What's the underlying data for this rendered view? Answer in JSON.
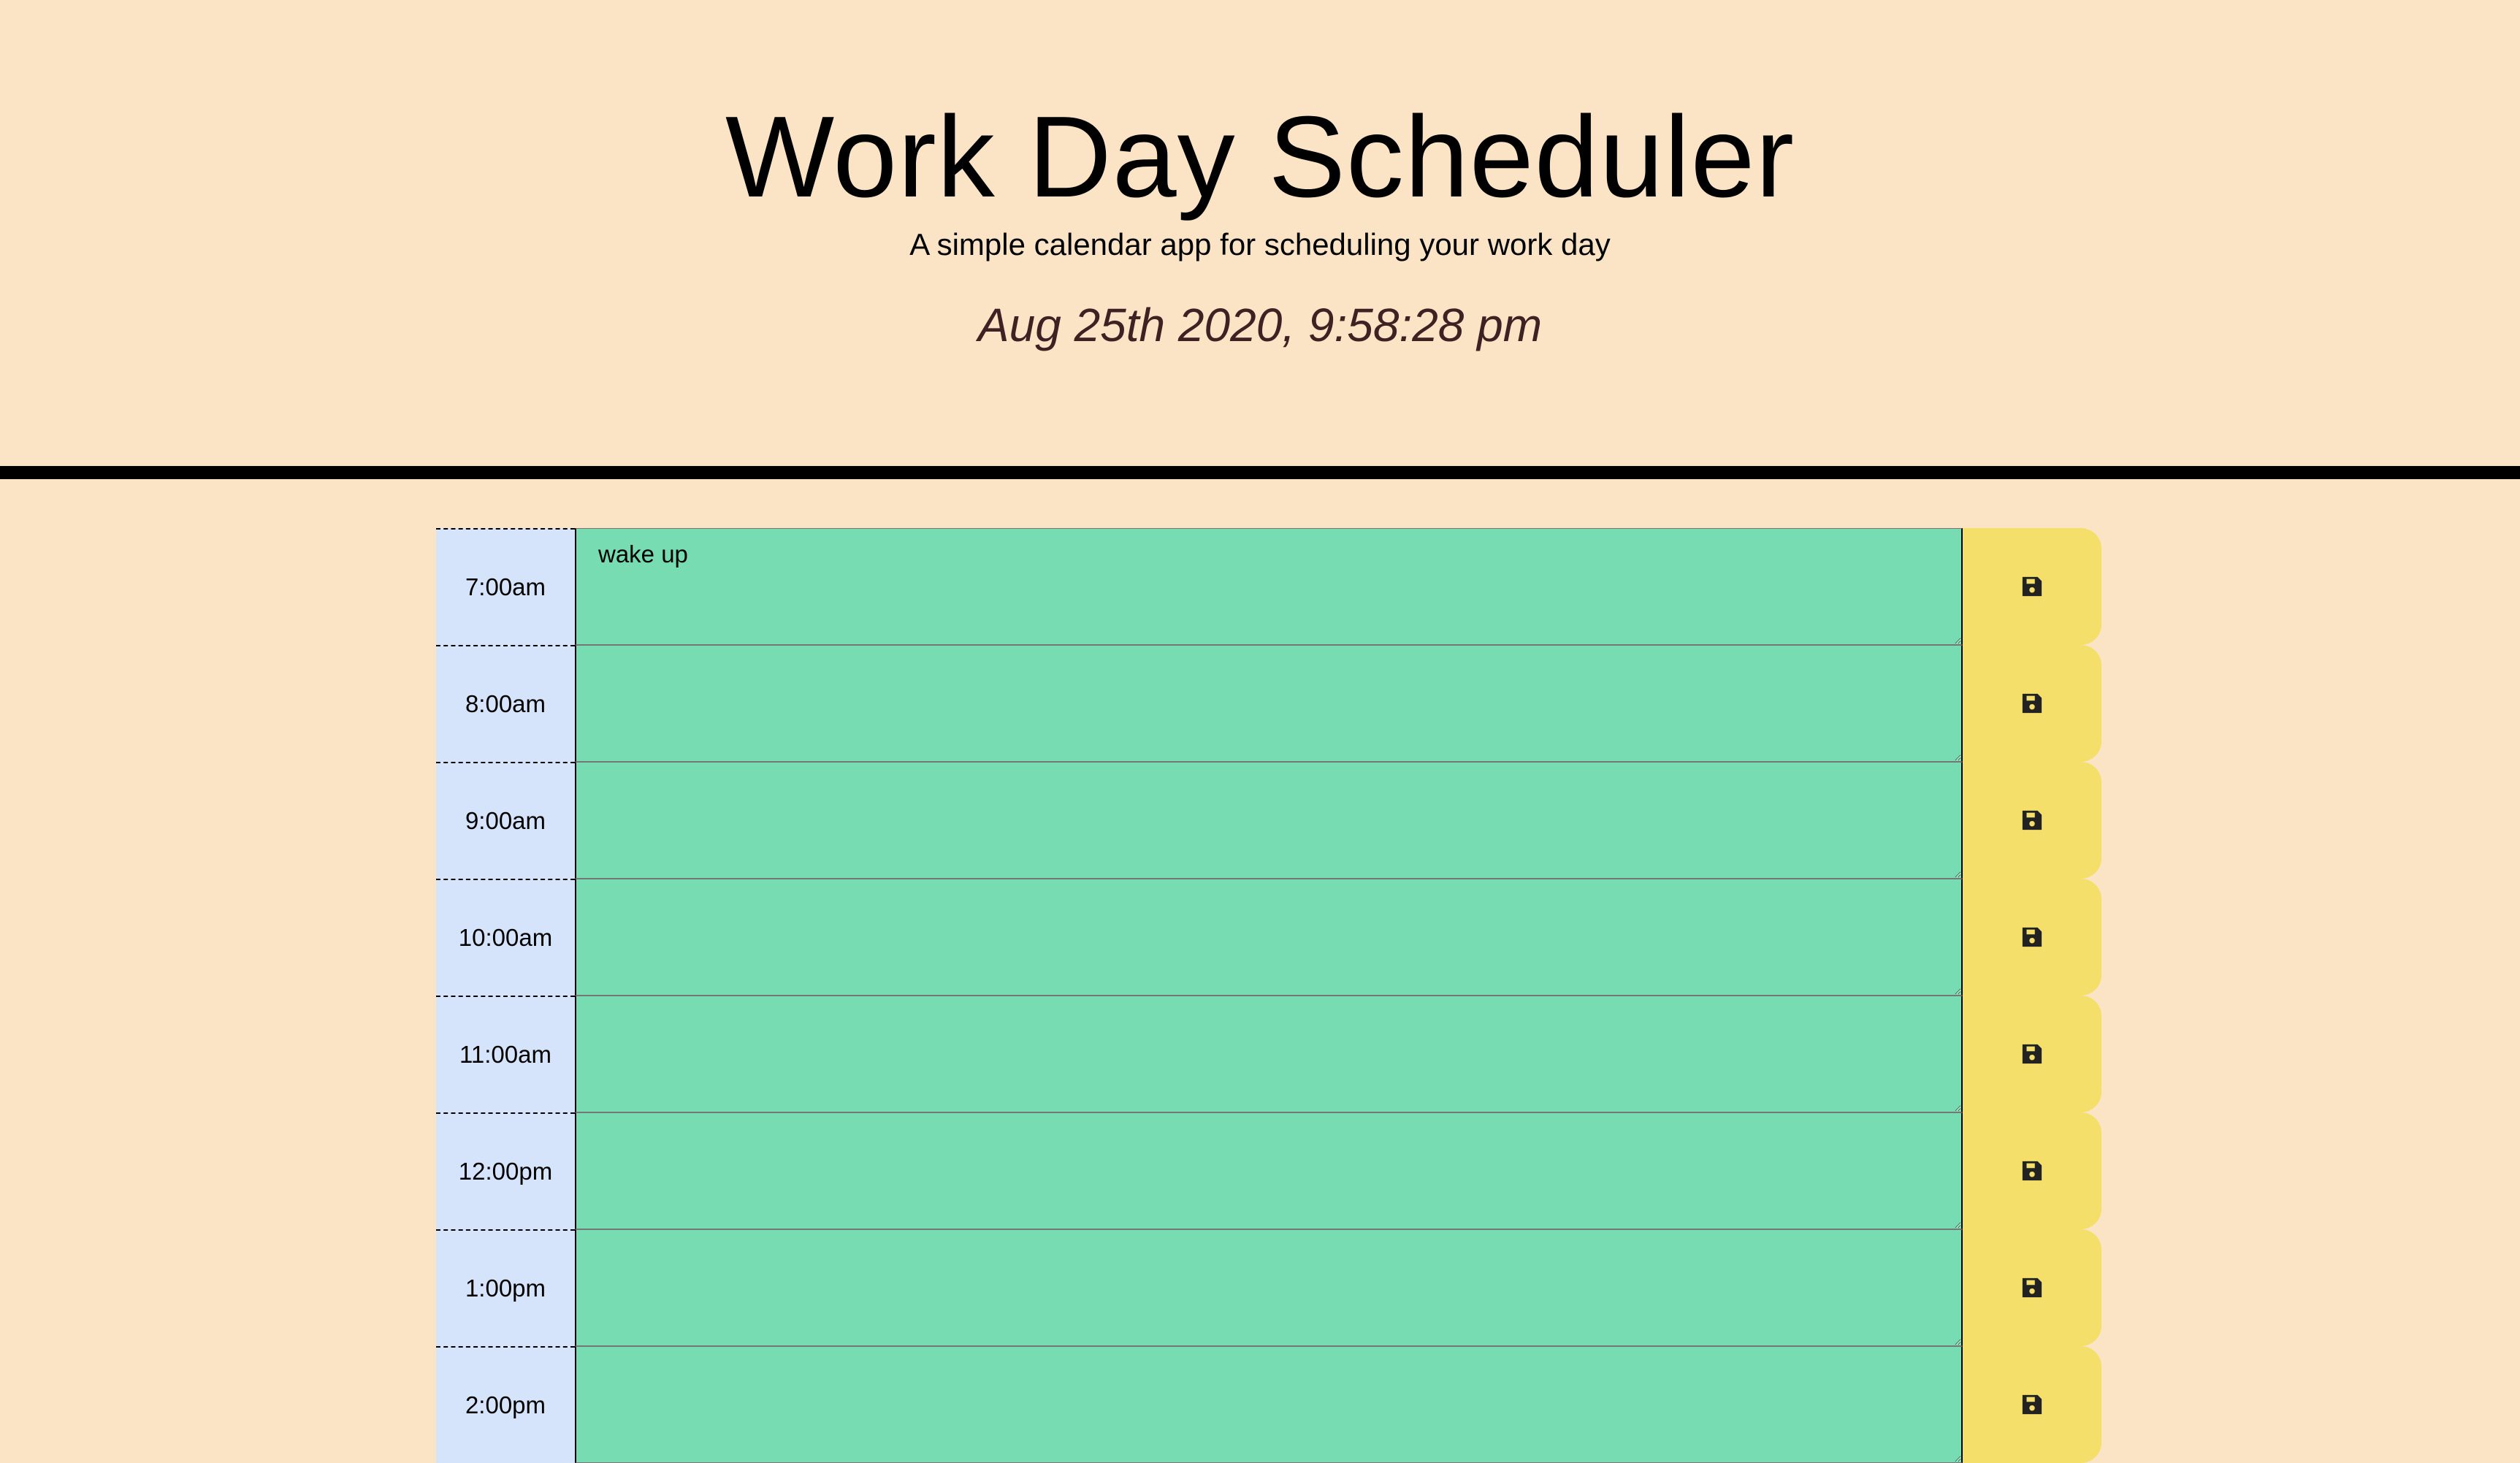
{
  "header": {
    "title": "Work Day Scheduler",
    "subtitle": "A simple calendar app for scheduling your work day",
    "current_datetime": "Aug 25th 2020, 9:58:28 pm"
  },
  "schedule": {
    "rows": [
      {
        "hour": "7:00am",
        "text": "wake up"
      },
      {
        "hour": "8:00am",
        "text": ""
      },
      {
        "hour": "9:00am",
        "text": ""
      },
      {
        "hour": "10:00am",
        "text": ""
      },
      {
        "hour": "11:00am",
        "text": ""
      },
      {
        "hour": "12:00pm",
        "text": ""
      },
      {
        "hour": "1:00pm",
        "text": ""
      },
      {
        "hour": "2:00pm",
        "text": ""
      }
    ],
    "save_icon": "floppy-disk-icon"
  },
  "colors": {
    "background": "#fbe3c6",
    "hour_column": "#d6e4fb",
    "future_row": "#77dcb1",
    "save_button": "#f4df6a"
  }
}
